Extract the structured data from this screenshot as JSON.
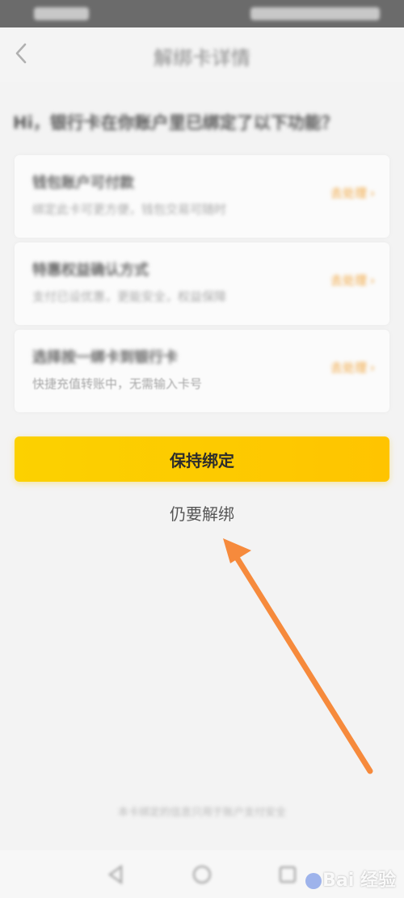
{
  "header": {
    "title": "解绑卡详情"
  },
  "question": "Hi，银行卡在你账户里已绑定了以下功能？",
  "options": [
    {
      "title": "钱包账户可付款",
      "desc": "绑定此卡可更方便，钱包交易可随时",
      "tag": "去处理"
    },
    {
      "title": "特惠权益确认方式",
      "desc": "支付已设优惠，更能安全，权益保障",
      "tag": "去处理"
    },
    {
      "title": "选择按一绑卡到银行卡",
      "desc": "快捷充值转账中，无需输入卡号",
      "tag": "去处理"
    }
  ],
  "actions": {
    "keep_label": "保持绑定",
    "unbind_label": "仍要解绑"
  },
  "footer": {
    "note": "本卡绑定的信息只用于账户支付安全"
  },
  "watermark": {
    "text": "Bai 经验"
  },
  "colors": {
    "accent": "#fdca00",
    "tag": "#f0a33a",
    "annotation_arrow": "#f68a3c"
  }
}
